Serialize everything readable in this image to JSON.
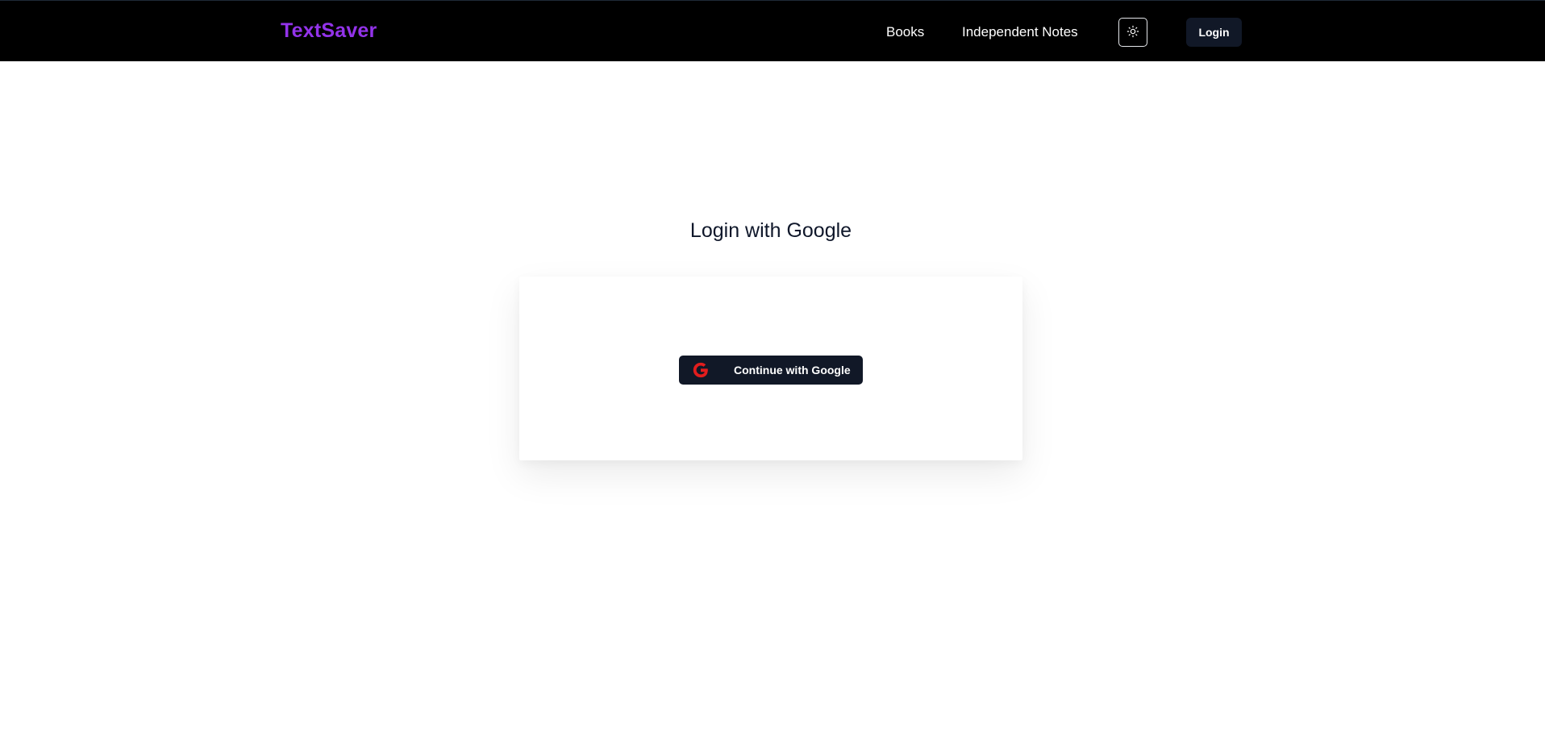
{
  "navbar": {
    "brand": "TextSaver",
    "links": [
      {
        "label": "Books"
      },
      {
        "label": "Independent Notes"
      }
    ],
    "theme_toggle_icon": "sun-icon",
    "login_label": "Login"
  },
  "main": {
    "heading": "Login with Google",
    "google_button": {
      "label": "Continue with Google",
      "icon": "google-icon"
    }
  },
  "colors": {
    "navbar_bg": "#000000",
    "brand": "#9333ea",
    "button_bg": "#111827",
    "google_icon": "#e11d1d",
    "heading": "#0f172a"
  }
}
